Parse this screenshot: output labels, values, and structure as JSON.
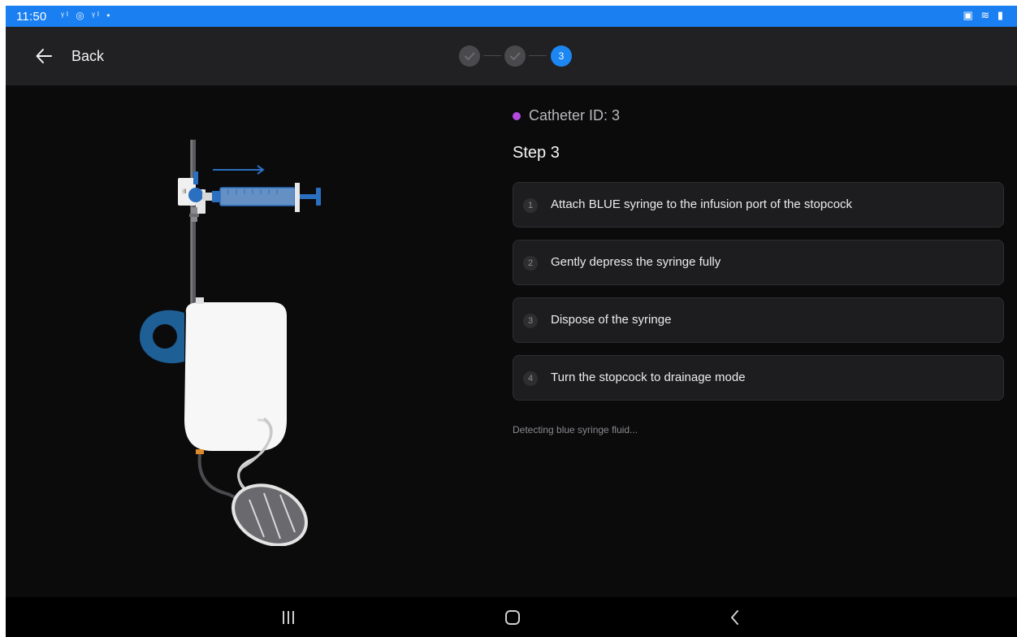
{
  "status_bar": {
    "time": "11:50",
    "left_icons": "ᵞᴵ ◎ ᵞᴵ •",
    "right_icons": "▣ ≋ ▮"
  },
  "header": {
    "back_label": "Back",
    "stepper": {
      "total_steps": 3,
      "completed_steps": 2,
      "current_step_label": "3"
    }
  },
  "main": {
    "catheter_label": "Catheter ID: 3",
    "catheter_dot_color": "#b44be1",
    "step_title": "Step 3",
    "steps": [
      {
        "number": "1",
        "text": "Attach BLUE syringe to the infusion port of the stopcock"
      },
      {
        "number": "2",
        "text": "Gently depress the syringe fully"
      },
      {
        "number": "3",
        "text": "Dispose of the syringe"
      },
      {
        "number": "4",
        "text": "Turn the stopcock to drainage mode"
      }
    ],
    "status_text": "Detecting blue syringe fluid..."
  },
  "colors": {
    "accent": "#1c86f2",
    "status_bar": "#1a7ff0",
    "background": "#0b0b0c",
    "header": "#212123",
    "card": "#1d1d1f",
    "syringe_blue": "#2a6fc0",
    "handle_blue": "#1e5f96"
  },
  "navigation": {
    "recents_icon": "recents-icon",
    "home_icon": "home-icon",
    "back_icon": "nav-back-icon"
  }
}
